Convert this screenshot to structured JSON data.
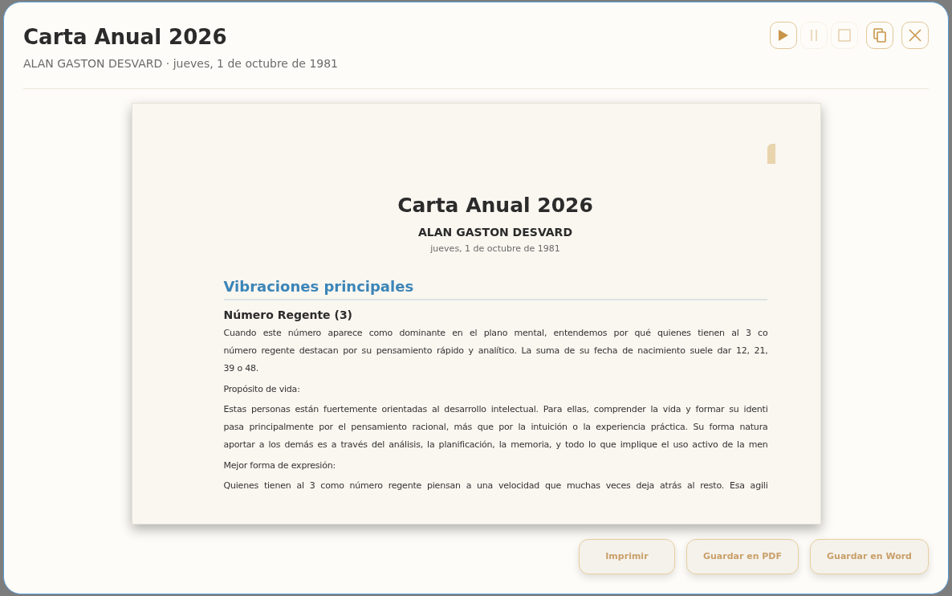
{
  "dialog": {
    "title": "Carta Anual 2026",
    "subtitle": "ALAN GASTON DESVARD · jueves, 1 de octubre de 1981"
  },
  "toolbar": [
    {
      "kind": "play",
      "disabled": false
    },
    {
      "kind": "pause",
      "disabled": true
    },
    {
      "kind": "stop",
      "disabled": true
    },
    {
      "kind": "copy",
      "disabled": false
    },
    {
      "kind": "close",
      "disabled": false
    }
  ],
  "document": {
    "title": "Carta Anual 2026",
    "name": "ALAN GASTON DESVARD",
    "date": "jueves, 1 de octubre de 1981",
    "section": "Vibraciones principales",
    "subsection": "Número Regente (3)",
    "blocks": [
      {
        "kind": "paragraph",
        "lines": [
          "Cuando este número aparece como dominante en el plano mental, entendemos por qué quienes tienen al 3 co",
          "número regente destacan por su pensamiento rápido y analítico. La suma de su fecha de nacimiento suele dar 12, 21,",
          "39 o 48."
        ]
      },
      {
        "kind": "label",
        "lines": [
          "Propósito de vida:"
        ]
      },
      {
        "kind": "paragraph",
        "lines": [
          "Estas personas están fuertemente orientadas al desarrollo intelectual. Para ellas, comprender la vida y formar su identi",
          "pasa principalmente por el pensamiento racional, más que por la intuición o la experiencia práctica. Su forma natura",
          "aportar a los demás es a través del análisis, la planificación, la memoria, y todo lo que implique el uso activo de la men"
        ]
      },
      {
        "kind": "label",
        "lines": [
          "Mejor forma de expresión:"
        ]
      },
      {
        "kind": "paragraph",
        "lines": [
          "Quienes tienen al 3 como número regente piensan a una velocidad que muchas veces deja atrás al resto. Esa agili"
        ]
      }
    ]
  },
  "actions": [
    "Imprimir",
    "Guardar en PDF",
    "Guardar en Word"
  ]
}
